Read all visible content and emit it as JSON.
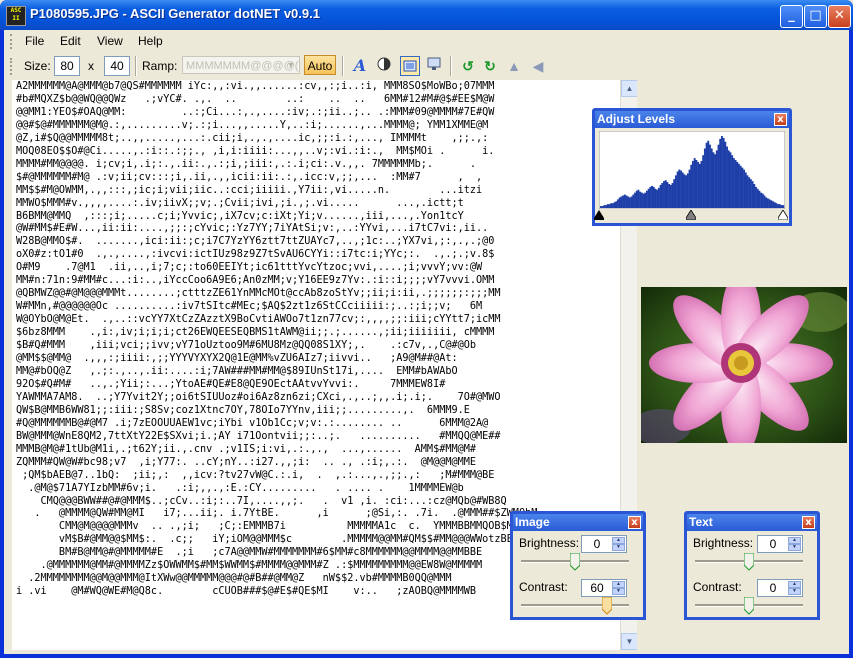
{
  "window": {
    "title": "P1080595.JPG - ASCII Generator dotNET v0.9.1",
    "app_icon_text": "ASC II",
    "minimize_label": "_",
    "maximize_label": "□",
    "close_label": "✕"
  },
  "menu": {
    "items": [
      "File",
      "Edit",
      "View",
      "Help"
    ]
  },
  "toolbar": {
    "size_label": "Size:",
    "width_value": "80",
    "x_label": "x",
    "height_value": "40",
    "ramp_label": "Ramp:",
    "ramp_value": "MMMMMMM@@@@(",
    "auto_label": "Auto",
    "icons": [
      "font-icon",
      "contrast-icon",
      "frame-icon",
      "monitor-icon",
      "rotate-left-icon",
      "rotate-right-icon",
      "flip-vertical-icon",
      "flip-horizontal-icon"
    ]
  },
  "ascii_output": [
    "A2MMMMMM@A@MMM@b7@QS#MMMMMM iYc:,,:vi.,,......:cv,,:;i..:i, MMM8SO$MoWBo;07MMM",
    "#b#MQXZ$b@@WQ@@QWz   .;vYC#. .,.  ..        ..:    ..  ..   6MM#12#M#@$#EE$M@W",
    "@@MM1:YEO$#OAQ@MM:         ..:;Ci...:,.,....:iv;.:;ii..;.. .:MMM#09@MMMM#7E#QW",
    "@@#$@#MMMMMM@M@.:,.........v;.:;i...,,.....Y,..:i;......,...MMMM@; YMM1XMME@M",
    "@Z,i#$Q@@MMMMM8t;..,,.....,...:.cii;i,.,.,....ic,;;:i.:,..., IMMMMt    ,;;.,:",
    "MOQ08EO$$O#@Ci.....,.:i::.:;;., ,i,i:iiii:...,,..v;:vi.:i:.,  MM$MOi .      i.",
    "MMMM#MM@@@@. i;cv;i,.i;:.,.ii:.,.:;i,;iii:,.:.i;ci:.v.,,. 7MMMMMMb;.      .",
    "$#@MMMMMM#M@ .:v;ii;cv:::;i,.ii,.,,icii:ii:.:,.icc:v,;;,...  :MM#7      ,  ,",
    "MM$$#M@OWMM,.,,:::,;ic;i;vii;iic..:cci;iiiii.,Y7ii:,vi.....n.        ...itzi",
    "MMWO$MMM#v.,,,,....:.iv;iivX;;v;.;Cvii;ivi,;i.,;.vi.....      ...,.ictt;t",
    "B6BMM@MMQ  ,:::;i;.....c;i;Yvvic;,iX7cv;c:iXt;Yi;v......,iii,...,.Yon1tcY",
    "@W#MM$#E#W...,ii:ii:....,;;:;cYvic;:Yz7YY;7iYAtSi;v:,..:YYvi,...i7tC7vi:,ii..",
    "W28B@MMO$#.  .......,ici:ii:;c;i7C7YzYY6ztt7ttZUAYc7,..,;1c:..;YX7vi,;:,.,.;@0",
    "oX0#z:tO1#0  .,.,....,:ivcvi:ictIUz98z9Z7tSvAU6CYYi::i7tc:i;YYc;:.  .,.;.;v.8$",
    "O#M9    .7@M1  .ii,..,i;7;c;:to60EEIYt;ic61tttYvcYtzoc;vvi,....;i;vvvY;vv:@W",
    "MM#n:71n:9#MM#c...:i:..,iYccCoo6A9E6;An0zMM;v;Y16EE9z7Yv:.:i::i;;;;vY7vvvi.OMM",
    "@QBMWZ@@#@M@@@MMMt........;ctttzZE61YnMMcMOt@ccAb8zoStYv;;ii;i:ii,.;;;;;;:;;;MM",
    "W#MMn,#@@@@@@Oc ..........:iv7tSItc#MEc;$AQ$2zt1z6StCCciiiii:;..:;i;;v;   6M",
    "W@OYbO@M@Et.  .,..::vcYY7XtCzZAzztX9BoCvtiAWOo7t1zn77cv;:,,,,;;:iii;cYYtt7;icMM",
    "$6bz8MMM    .,i:,iv;i;i;i;ct26EWQEESEQBMS1tAWM@ii;;.;......,;ii;iiiiiii, cMMMM",
    "$B#Q#MMM    ,iii;vci;;ivv;vY71oUztoo9M#6MU8Mz@QQ08S1XY;,.    .:c7v,.,C@#@Ob",
    "@MM$$@MM@  .,,,:;iiii:,;;YYYVYXYX2Q@1E@MM%vZU6AIz7;iivvi..   ;A9@M##@At:",
    "MM@#bOQ@Z   ,.;:.,..,.ii:....:i;7AW###MM#MM@$89IUnSt17i,....  EMM#bAWAbO",
    "92O$#Q#M#   ..,.;Yii;:...;YtoAE#QE#E8@QE9OEctAAtvvYvvi:.     7MMMEW8I#",
    "YAWMMA7AM8.  ..;Y7Yvit2Y;;oi6tSIUUoz#oi6Az8zn6zi;CXci,.,..;,,.i;.i;.    7O#@MWO",
    "QW$B@MMB6WW81;;:iii:;S8Sv;coz1Xtnc7OY,78OIo7YYnv,iii;;.........,.  6MMM9.E",
    "#Q@MMMMMMB@#@M7 .i;7zEOOUUAEW1vc;iYbi v1Ob1Cc;v;v:.:........ ..      6MMM@2A@",
    "BW@MMM@WnE8QM2,7ttXtY22E$SXvi;i.;AY i71Oontvii;;:..;.   ..........   #MMQQ@ME##",
    "MMMB@M@#1tUb@M1i,.;t62Y;ii.,.cnv .;v1IS;i:vi,.:.,.,  ...,......  AMM$#MM@M#",
    "ZQMMM#QW@W#bc98;v7  ,i;Y77:. ..cY;nY..:i27.,,;i:  .. ., .:i;,.:.  @M@@M@MME",
    " ;QM$bAEB@7..1bQ:  ;ii;,:  ,,icv:?tv27vW@C.:.i,  .  ,.:...,.,;;.,:   ;M#MMM@BE",
    "  .@M@$71A7YIzbMM#6v;i.   .:i;,,.,:E.:CY.........   . .... .    1MMMMEW@b",
    "    CMQ@@@BWW##@#@MMM$..;cCv..:i;:..7I,....,,;.   .  v1 ,i. :ci:...:cz@MQb@#WB8Q",
    "   .   @MMMM@QW#MM@MI   i7;...ii;. i.7YtBE.      ,i      ;@Si,:. .7i.  .@MMM##$ZWMQbM",
    "       CMM@M@@@@MMMv  .. .,;i;   ;C;:EMMMB7i          MMMMMA1c  c.  YMMMBBMMQOB$MM",
    "       vM$B#@MM@@$MM$:.  .c;;   iY;iOM@@MMM$c        .MMMMM@@MM#QM$$#MM@@@WWotzBE",
    "       BM#B@MM@#@MMMMM#E  .;i   ;c7A@@MMW#MMMMMMM#6$MM#c8MMMMMM@@MMMM@@MMBBE",
    "    .@MMMMMM@MM#@MMMMZz$OWWMM$#MM$WWMM$#MMMM@@MMM#Z .:$MMMMMMMMM@@EW8W@MMMMM",
    "  .2MMMMMMMM@@M@@MMM@ItXWw@@MMMMM@@@#@#B##@MM@Z   nW$$2.vb#MMMMB0QQ@MMM",
    "i .vi    @M#WQ@WE#M@Q8c.        cCUOB###$@#E$#QE$MI    v:..   ;zAOBQ@MMMMWB"
  ],
  "adjust_levels": {
    "title": "Adjust Levels",
    "close_label": "x",
    "histogram": [
      2,
      2,
      3,
      3,
      4,
      4,
      5,
      5,
      6,
      7,
      9,
      11,
      12,
      13,
      14,
      13,
      12,
      11,
      12,
      14,
      16,
      18,
      19,
      17,
      16,
      15,
      16,
      18,
      20,
      22,
      23,
      22,
      20,
      19,
      21,
      24,
      26,
      28,
      29,
      27,
      25,
      24,
      26,
      30,
      34,
      38,
      40,
      39,
      37,
      35,
      34,
      36,
      40,
      45,
      49,
      52,
      50,
      48,
      46,
      49,
      55,
      62,
      68,
      70,
      66,
      62,
      58,
      56,
      60,
      66,
      72,
      75,
      73,
      69,
      64,
      60,
      58,
      55,
      52,
      50,
      48,
      46,
      44,
      42,
      40,
      37,
      34,
      32,
      30,
      28,
      25,
      22,
      20,
      18,
      16,
      15,
      13,
      11,
      10,
      9,
      8,
      7,
      6,
      5,
      4,
      4,
      3,
      3
    ],
    "black_point": 0,
    "mid_point": 0.5,
    "white_point": 1
  },
  "image_panel": {
    "title": "Image",
    "close_label": "x",
    "brightness_label": "Brightness:",
    "brightness_value": "0",
    "contrast_label": "Contrast:",
    "contrast_value": "60",
    "brightness_level": 0.5,
    "contrast_level": 0.8
  },
  "text_panel": {
    "title": "Text",
    "close_label": "x",
    "brightness_label": "Brightness:",
    "brightness_value": "0",
    "contrast_label": "Contrast:",
    "contrast_value": "0",
    "brightness_level": 0.5,
    "contrast_level": 0.5
  },
  "colors": {
    "titlebar": "#0a5ee0",
    "accent": "#2a56d6",
    "auto_button": "#f5c258",
    "histogram": "#1f3fa8"
  }
}
